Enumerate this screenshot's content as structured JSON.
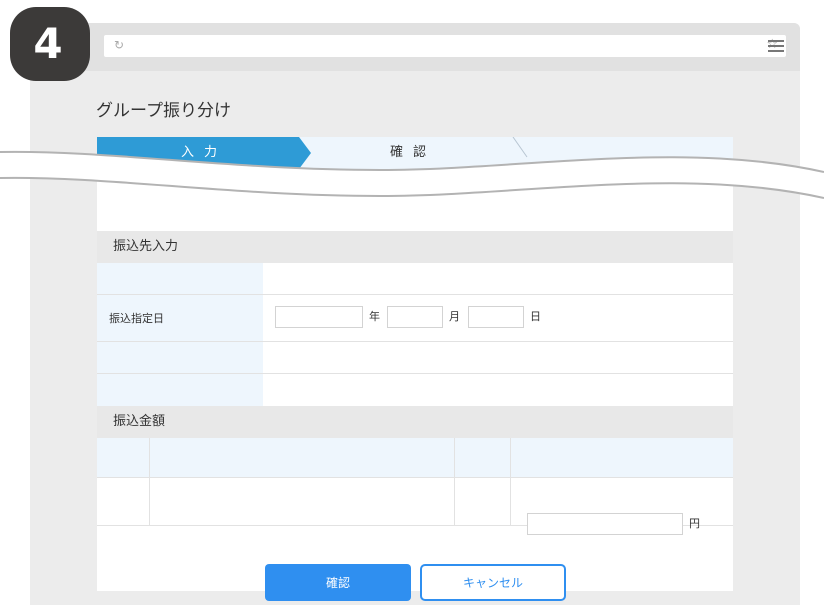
{
  "step_badge": {
    "number": "4"
  },
  "browser": {
    "reload_icon": "reload-icon",
    "star_icon": "star-icon",
    "menu_icon": "hamburger-menu-icon"
  },
  "page": {
    "title": "グループ振り分け"
  },
  "steps": {
    "active_label": "入力",
    "confirm_label": "確認"
  },
  "sections": {
    "transfer_dest_title": "振込先入力",
    "transfer_date_label": "振込指定日",
    "date_units": {
      "year": "年",
      "month": "月",
      "day": "日"
    },
    "amount_title": "振込金額",
    "yen_unit": "円"
  },
  "buttons": {
    "confirm": "確認",
    "cancel": "キャンセル"
  },
  "colors": {
    "accent": "#2f8ff0",
    "step_active": "#2e9bd6",
    "label_bg": "#eef6fd",
    "section_bg": "#e8e8e8",
    "badge_bg": "#3c3a39"
  }
}
